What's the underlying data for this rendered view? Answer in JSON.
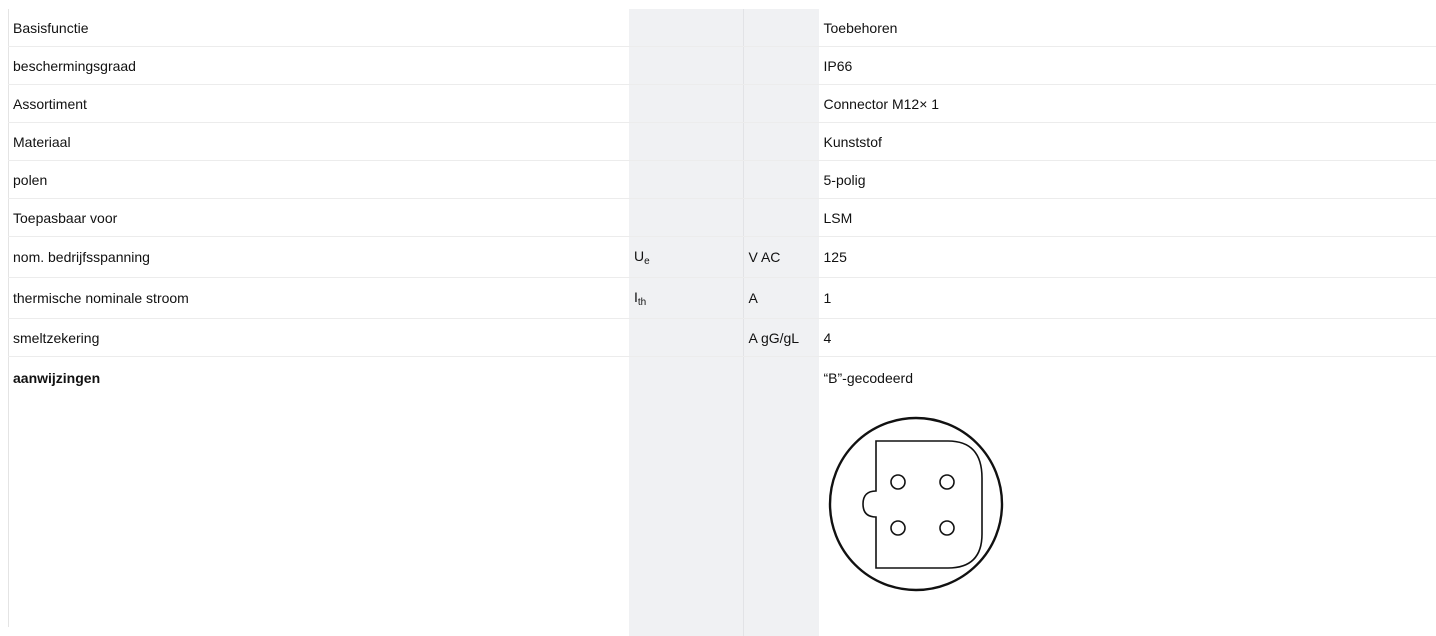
{
  "page": {
    "heading_fragment": "Toebehoren"
  },
  "rows": [
    {
      "label": "Basisfunctie",
      "symbol": "",
      "symbol_sub": "",
      "unit": "",
      "value": "Toebehoren"
    },
    {
      "label": "beschermingsgraad",
      "symbol": "",
      "symbol_sub": "",
      "unit": "",
      "value": "IP66"
    },
    {
      "label": "Assortiment",
      "symbol": "",
      "symbol_sub": "",
      "unit": "",
      "value": "Connector M12× 1"
    },
    {
      "label": "Materiaal",
      "symbol": "",
      "symbol_sub": "",
      "unit": "",
      "value": "Kunststof"
    },
    {
      "label": "polen",
      "symbol": "",
      "symbol_sub": "",
      "unit": "",
      "value": "5-polig"
    },
    {
      "label": "Toepasbaar voor",
      "symbol": "",
      "symbol_sub": "",
      "unit": "",
      "value": "LSM"
    },
    {
      "label": "nom. bedrijfsspanning",
      "symbol": "U",
      "symbol_sub": "e",
      "unit": "V AC",
      "value": "125"
    },
    {
      "label": "thermische nominale stroom",
      "symbol": "I",
      "symbol_sub": "th",
      "unit": "A",
      "value": "1"
    },
    {
      "label": "smeltzekering",
      "symbol": "",
      "symbol_sub": "",
      "unit": "A gG/gL",
      "value": "4"
    }
  ],
  "notes": {
    "label": "aanwijzingen",
    "value": "“B”-gecodeerd"
  },
  "colors": {
    "heading": "#1f6fd0",
    "shaded_column": "#f0f1f3",
    "row_divider": "#ececec"
  }
}
